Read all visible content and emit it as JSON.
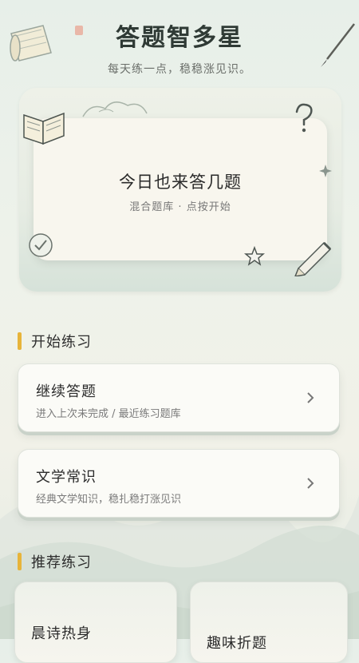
{
  "header": {
    "title": "答题智多星",
    "subtitle": "每天练一点，稳稳涨见识。"
  },
  "hero": {
    "title": "今日也来答几题",
    "subtitle": "混合题库 · 点按开始"
  },
  "sections": {
    "start_practice": "开始练习",
    "recommended": "推荐练习"
  },
  "practice_cards": [
    {
      "title": "继续答题",
      "description": "进入上次未完成 / 最近练习题库"
    },
    {
      "title": "文学常识",
      "description": "经典文学知识，稳扎稳打涨见识"
    }
  ],
  "recommended_cards": [
    {
      "title": "晨诗热身"
    },
    {
      "title": "趣味折题"
    }
  ],
  "colors": {
    "accent": "#e7b43a",
    "background": "#eef2ea",
    "card": "#fbfbf7"
  },
  "icons": [
    "book-icon",
    "scroll-icon",
    "brush-icon",
    "question-mark-icon",
    "star-icon",
    "pencil-icon",
    "check-icon",
    "chevron-right-icon"
  ]
}
